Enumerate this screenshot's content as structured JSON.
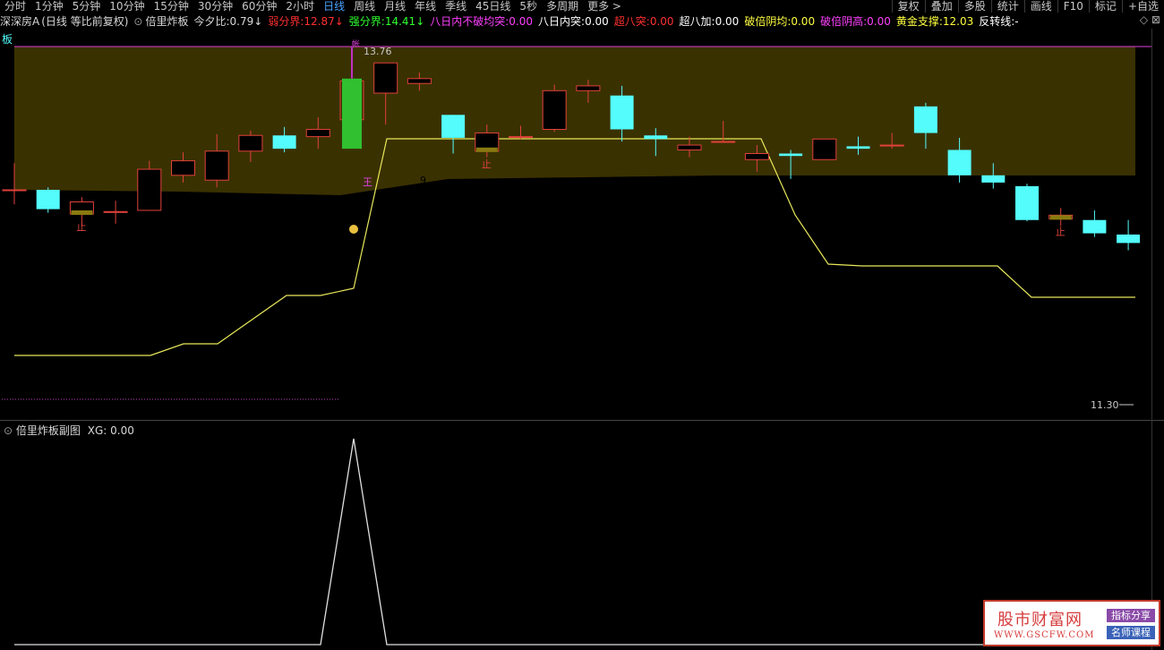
{
  "toolbar": {
    "periods": [
      {
        "label": "分时",
        "active": false
      },
      {
        "label": "1分钟",
        "active": false
      },
      {
        "label": "5分钟",
        "active": false
      },
      {
        "label": "10分钟",
        "active": false
      },
      {
        "label": "15分钟",
        "active": false
      },
      {
        "label": "30分钟",
        "active": false
      },
      {
        "label": "60分钟",
        "active": false
      },
      {
        "label": "2小时",
        "active": false
      },
      {
        "label": "日线",
        "active": true
      },
      {
        "label": "周线",
        "active": false
      },
      {
        "label": "月线",
        "active": false
      },
      {
        "label": "年线",
        "active": false
      },
      {
        "label": "季线",
        "active": false
      },
      {
        "label": "45日线",
        "active": false
      },
      {
        "label": "5秒",
        "active": false
      },
      {
        "label": "多周期",
        "active": false
      },
      {
        "label": "更多 >",
        "active": false
      }
    ],
    "right_tools": [
      "复权",
      "叠加",
      "多股",
      "统计",
      "画线",
      "F10",
      "标记",
      "+自选"
    ]
  },
  "info": {
    "stock": "深深房A",
    "mode": "(日线 等比前复权)",
    "indicator": "倍里炸板",
    "items": [
      {
        "label": "今夕比:",
        "value": "0.79",
        "arrow": "↓",
        "color": "#d8d8d8"
      },
      {
        "label": "弱分界:",
        "value": "12.87",
        "arrow": "↓",
        "color": "#ff3030"
      },
      {
        "label": "强分界:",
        "value": "14.41",
        "arrow": "↓",
        "color": "#30ff30"
      },
      {
        "label": "八日内不破均突:",
        "value": "0.00",
        "arrow": "",
        "color": "#ff40ff"
      },
      {
        "label": "八日内突:",
        "value": "0.00",
        "arrow": "",
        "color": "#ffffff"
      },
      {
        "label": "超八突:",
        "value": "0.00",
        "arrow": "",
        "color": "#ff3030"
      },
      {
        "label": "超八加:",
        "value": "0.00",
        "arrow": "",
        "color": "#ffffff"
      },
      {
        "label": "破倍阴均:",
        "value": "0.00",
        "arrow": "",
        "color": "#ffff40"
      },
      {
        "label": "破倍阴高:",
        "value": "0.00",
        "arrow": "",
        "color": "#ff40ff"
      },
      {
        "label": "黄金支撑:",
        "value": "12.03",
        "arrow": "",
        "color": "#ffff40"
      },
      {
        "label": "反转线:",
        "value": "-",
        "arrow": "",
        "color": "#ffffff"
      }
    ],
    "controls": "◇ ⊠"
  },
  "main_chart": {
    "corner_label": "板",
    "price_high_label": "13.76",
    "price_low_label": "11.30",
    "wang_label": "王",
    "badge_number": "9",
    "stop_label": "止",
    "band_color": "#3a3100",
    "up_color": "#e0413a",
    "down_color": "#54fcfc",
    "support_color": "#e8e85a",
    "ylim": [
      11.0,
      14.0
    ]
  },
  "chart_data": {
    "type": "candlestick",
    "candles": [
      {
        "o": 12.8,
        "h": 13.02,
        "l": 12.68,
        "c": 12.8
      },
      {
        "o": 12.8,
        "h": 12.82,
        "l": 12.61,
        "c": 12.64
      },
      {
        "o": 12.6,
        "h": 12.74,
        "l": 12.5,
        "c": 12.7,
        "stop": true
      },
      {
        "o": 12.62,
        "h": 12.71,
        "l": 12.52,
        "c": 12.62
      },
      {
        "o": 12.63,
        "h": 13.04,
        "l": 12.63,
        "c": 12.97
      },
      {
        "o": 12.92,
        "h": 13.11,
        "l": 12.86,
        "c": 13.04
      },
      {
        "o": 12.88,
        "h": 13.26,
        "l": 12.82,
        "c": 13.12
      },
      {
        "o": 13.12,
        "h": 13.29,
        "l": 13.03,
        "c": 13.25
      },
      {
        "o": 13.25,
        "h": 13.32,
        "l": 13.11,
        "c": 13.14
      },
      {
        "o": 13.24,
        "h": 13.4,
        "l": 13.14,
        "c": 13.3
      },
      {
        "o": 13.5,
        "h": 13.5,
        "l": 13.38,
        "c": 13.5,
        "zha": true
      },
      {
        "o": 13.6,
        "h": 13.85,
        "l": 13.34,
        "c": 13.85
      },
      {
        "o": 13.68,
        "h": 13.77,
        "l": 13.62,
        "c": 13.72,
        "badge": true
      },
      {
        "o": 13.42,
        "h": 13.42,
        "l": 13.1,
        "c": 13.23
      },
      {
        "o": 13.12,
        "h": 13.34,
        "l": 13.07,
        "c": 13.27,
        "stop": true
      },
      {
        "o": 13.24,
        "h": 13.33,
        "l": 13.22,
        "c": 13.24
      },
      {
        "o": 13.3,
        "h": 13.67,
        "l": 13.28,
        "c": 13.62
      },
      {
        "o": 13.62,
        "h": 13.71,
        "l": 13.52,
        "c": 13.66
      },
      {
        "o": 13.58,
        "h": 13.66,
        "l": 13.2,
        "c": 13.3
      },
      {
        "o": 13.25,
        "h": 13.31,
        "l": 13.08,
        "c": 13.22
      },
      {
        "o": 13.13,
        "h": 13.24,
        "l": 13.07,
        "c": 13.17
      },
      {
        "o": 13.2,
        "h": 13.37,
        "l": 13.19,
        "c": 13.2
      },
      {
        "o": 13.05,
        "h": 13.17,
        "l": 12.95,
        "c": 13.1
      },
      {
        "o": 13.1,
        "h": 13.13,
        "l": 12.89,
        "c": 13.08
      },
      {
        "o": 13.05,
        "h": 13.2,
        "l": 13.05,
        "c": 13.22
      },
      {
        "o": 13.16,
        "h": 13.24,
        "l": 13.09,
        "c": 13.14
      },
      {
        "o": 13.17,
        "h": 13.27,
        "l": 13.14,
        "c": 13.17
      },
      {
        "o": 13.49,
        "h": 13.52,
        "l": 13.14,
        "c": 13.27
      },
      {
        "o": 13.13,
        "h": 13.23,
        "l": 12.86,
        "c": 12.92
      },
      {
        "o": 12.92,
        "h": 13.02,
        "l": 12.81,
        "c": 12.86
      },
      {
        "o": 12.83,
        "h": 12.85,
        "l": 12.54,
        "c": 12.55
      },
      {
        "o": 12.56,
        "h": 12.65,
        "l": 12.5,
        "c": 12.59,
        "stop": true
      },
      {
        "o": 12.55,
        "h": 12.63,
        "l": 12.41,
        "c": 12.44
      },
      {
        "o": 12.43,
        "h": 12.55,
        "l": 12.3,
        "c": 12.36
      }
    ]
  },
  "sub_chart": {
    "title": "倍里炸板副图",
    "value_label": "XG:",
    "value": "0.00"
  },
  "watermark": {
    "title": "股市财富网",
    "url": "WWW.GSCFW.COM",
    "badge1": "指标分享",
    "badge2": "名师课程"
  }
}
